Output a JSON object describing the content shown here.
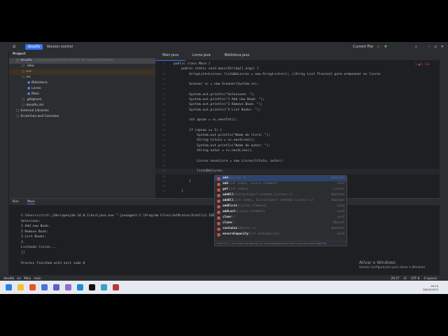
{
  "titlebar": {
    "project": "desafio",
    "vcs": "Version control",
    "run_config": "Current File"
  },
  "project_panel": {
    "header": "Project",
    "items": [
      {
        "label": "desafio",
        "hint": "C:\\Users\\crist\\OneDrive\\Área de Trabalho\\desafio",
        "depth": 0
      },
      {
        "label": ".idea",
        "depth": 1
      },
      {
        "label": "out",
        "depth": 1
      },
      {
        "label": "src",
        "depth": 1
      },
      {
        "label": "Biblioteca",
        "depth": 2
      },
      {
        "label": "Livros",
        "depth": 2
      },
      {
        "label": "Main",
        "depth": 2
      },
      {
        "label": ".gitignore",
        "depth": 1
      },
      {
        "label": "desafio.iml",
        "depth": 1
      },
      {
        "label": "External Libraries",
        "depth": 0
      },
      {
        "label": "Scratches and Consoles",
        "depth": 0
      }
    ]
  },
  "editor": {
    "tabs": [
      "Main.java",
      "Livros.java",
      "Biblioteca.java"
    ],
    "inspections": "1  ▲1  ✓12",
    "lines": [
      {
        "n": "6",
        "t": "public class Main {"
      },
      {
        "n": "7",
        "t": "    public static void main(String[] args) {"
      },
      {
        "n": "10",
        "t": "        ArrayList<Livros> listaDeLivros = new ArrayList<>(); //Array List flexível para armazenar os livros"
      },
      {
        "n": "11",
        "t": ""
      },
      {
        "n": "12",
        "t": "        Scanner sc = new Scanner(System.in);"
      },
      {
        "n": "13",
        "t": ""
      },
      {
        "n": "14",
        "t": "        System.out.println(\"Selecione: \");"
      },
      {
        "n": "15",
        "t": "        System.out.println(\"1 Add new Book: \");"
      },
      {
        "n": "16",
        "t": "        System.out.println(\"2 Remove Book: \");"
      },
      {
        "n": "17",
        "t": "        System.out.println(\"3 List Books: \");"
      },
      {
        "n": "18",
        "t": ""
      },
      {
        "n": "19",
        "t": "        int opcao = sc.nextInt();"
      },
      {
        "n": "20",
        "t": ""
      },
      {
        "n": "21",
        "t": "        if (opcao == 1) {"
      },
      {
        "n": "22",
        "t": "            System.out.println(\"Nome do livro: \");"
      },
      {
        "n": "23",
        "t": "            String titulo = sc.nextLine();"
      },
      {
        "n": "24",
        "t": "            System.out.println(\"Nome do autor: \");"
      },
      {
        "n": "25",
        "t": "            String autor = sc.nextLine();"
      },
      {
        "n": "26",
        "t": ""
      },
      {
        "n": "27",
        "t": "            Livros novoLivro = new Livros(titulo, autor);"
      },
      {
        "n": "28",
        "t": ""
      },
      {
        "n": "29",
        "t": "            listaDeLivros."
      },
      {
        "n": "30",
        "t": ""
      },
      {
        "n": "31",
        "t": "        }"
      },
      {
        "n": "32",
        "t": ""
      },
      {
        "n": "33",
        "t": "    }"
      }
    ]
  },
  "completion": {
    "items": [
      {
        "name": "add",
        "args": "(Livros e)",
        "type": "boolean"
      },
      {
        "name": "add",
        "args": "(int index, Livros element)",
        "type": "void"
      },
      {
        "name": "get",
        "args": "(int index)",
        "type": "Livros"
      },
      {
        "name": "addAll",
        "args": "(Collection<? extends Livros> c)",
        "type": "boolean"
      },
      {
        "name": "addAll",
        "args": "(int index, Collection<? extends Livros> c)",
        "type": "boolean"
      },
      {
        "name": "addFirst",
        "args": "(Livros element)",
        "type": "void"
      },
      {
        "name": "addLast",
        "args": "(Livros element)",
        "type": "void"
      },
      {
        "name": "clear",
        "args": "()",
        "type": "void"
      },
      {
        "name": "clone",
        "args": "()",
        "type": "Object"
      },
      {
        "name": "contains",
        "args": "(Object o)",
        "type": "boolean"
      },
      {
        "name": "ensureCapacity",
        "args": "(int minCapacity)",
        "type": "void"
      }
    ],
    "tip": "Press Ctrl+. to choose the selected (or first) suggestion and insert a dot afterwards",
    "next_tip": "Next Tip"
  },
  "run_panel": {
    "tab_run": "Run",
    "tab_main": "Main",
    "output": [
      "C:\\Users\\crist\\.jdks\\openjdk-24.0.1\\bin\\java.exe \"-javaagent:C:\\Program Files\\JetBrains\\IntelliJ IDEA C... -Dsun.stdout.encoding=UTF-8 -Dsun.stderr.encoding",
      "Selecione:",
      "1 Add new Book:",
      "2 Remove Book:",
      "3 List Books:",
      "3",
      "Listando livros...",
      "[]",
      "",
      "Process finished with exit code 0"
    ]
  },
  "statusbar": {
    "crumbs": [
      "desafio",
      "src",
      "Main",
      "main"
    ],
    "pos": "29:27",
    "le": "LF",
    "enc": "UTF-8",
    "indent": "4 spaces"
  },
  "watermark": {
    "title": "Ativar o Windows",
    "sub": "Acesse Configurações para ativar o Windows."
  },
  "taskbar": {
    "time": "18:10",
    "date": "28/05/2025"
  }
}
